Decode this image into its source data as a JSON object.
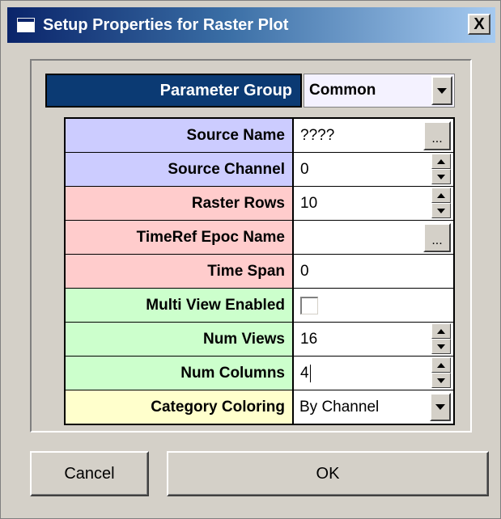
{
  "window": {
    "title": "Setup Properties for Raster Plot",
    "close_label": "X"
  },
  "parameter_group": {
    "label": "Parameter Group",
    "value": "Common"
  },
  "rows": [
    {
      "label": "Source Name",
      "value": "????",
      "color": "#ccccff",
      "control": "text-browse",
      "browse_label": "..."
    },
    {
      "label": "Source Channel",
      "value": "0",
      "color": "#ccccff",
      "control": "spinner"
    },
    {
      "label": "Raster Rows",
      "value": "10",
      "color": "#ffcccc",
      "control": "spinner"
    },
    {
      "label": "TimeRef Epoc Name",
      "value": "",
      "color": "#ffcccc",
      "control": "text-browse",
      "browse_label": "..."
    },
    {
      "label": "Time Span",
      "value": "0",
      "color": "#ffcccc",
      "control": "text"
    },
    {
      "label": "Multi View Enabled",
      "value": "",
      "checked": false,
      "color": "#ccffcc",
      "control": "checkbox"
    },
    {
      "label": "Num Views",
      "value": "16",
      "color": "#ccffcc",
      "control": "spinner"
    },
    {
      "label": "Num Columns",
      "value": "4",
      "color": "#ccffcc",
      "control": "spinner",
      "focused": true
    },
    {
      "label": "Category Coloring",
      "value": "By Channel",
      "color": "#ffffcc",
      "control": "dropdown"
    }
  ],
  "buttons": {
    "cancel_label": "Cancel",
    "ok_label": "OK"
  },
  "colors": {
    "title_bar": "#0a246a",
    "dialog_bg": "#d4d0c8",
    "group_header": "#0b3a73"
  }
}
